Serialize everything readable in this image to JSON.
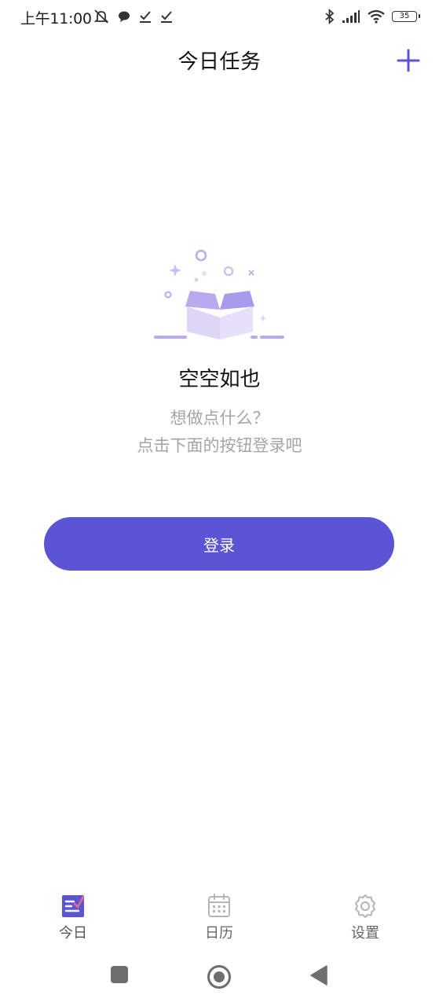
{
  "status_bar": {
    "time": "上午11:00",
    "battery": "35",
    "left_icons": [
      "alarm-off-icon",
      "chat-bubble-icon",
      "check-icon",
      "check-icon"
    ],
    "right_icons": [
      "bluetooth-icon",
      "signal-icon",
      "wifi-icon",
      "battery-icon"
    ]
  },
  "header": {
    "title": "今日任务",
    "add_icon": "plus-icon"
  },
  "empty_state": {
    "illustration": "open-box-illustration",
    "title": "空空如也",
    "line1": "想做点什么？",
    "line2": "点击下面的按钮登录吧"
  },
  "login": {
    "label": "登录"
  },
  "tabs": [
    {
      "label": "今日",
      "icon": "task-list-icon",
      "active": true
    },
    {
      "label": "日历",
      "icon": "calendar-icon",
      "active": false
    },
    {
      "label": "设置",
      "icon": "gear-icon",
      "active": false
    }
  ],
  "colors": {
    "accent": "#5b55d6",
    "illustration_light": "#ddd6f7",
    "illustration_mid": "#b9aaf0",
    "muted_text": "#a5a5a5",
    "inactive_icon": "#b5b5b5"
  }
}
